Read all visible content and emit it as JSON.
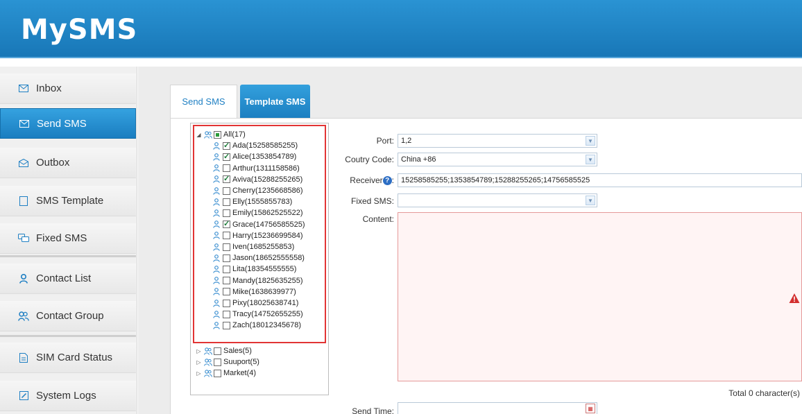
{
  "app": {
    "logo": "MySMS"
  },
  "sidebar": {
    "items": [
      {
        "label": "Inbox",
        "icon": "envelope-icon"
      },
      {
        "label": "Send SMS",
        "icon": "envelope-send-icon",
        "active": true
      },
      {
        "label": "Outbox",
        "icon": "envelope-open-icon"
      },
      {
        "label": "SMS Template",
        "icon": "template-icon"
      },
      {
        "label": "Fixed SMS",
        "icon": "chat-bubbles-icon"
      },
      {
        "label": "Contact List",
        "icon": "person-icon"
      },
      {
        "label": "Contact Group",
        "icon": "people-icon"
      },
      {
        "label": "SIM Card Status",
        "icon": "document-icon"
      },
      {
        "label": "System Logs",
        "icon": "edit-icon"
      }
    ]
  },
  "tabs": {
    "send": "Send SMS",
    "template": "Template SMS"
  },
  "tree": {
    "root": {
      "label": "All(17)",
      "state": "partial"
    },
    "contacts": [
      {
        "label": "Ada(15258585255)",
        "checked": true
      },
      {
        "label": "Alice(1353854789)",
        "checked": true
      },
      {
        "label": "Arthur(1311158586)",
        "checked": false
      },
      {
        "label": "Aviva(15288255265)",
        "checked": true
      },
      {
        "label": "Cherry(1235668586)",
        "checked": false
      },
      {
        "label": "Elly(1555855783)",
        "checked": false
      },
      {
        "label": "Emily(15862525522)",
        "checked": false
      },
      {
        "label": "Grace(14756585525)",
        "checked": true
      },
      {
        "label": "Harry(15236699584)",
        "checked": false
      },
      {
        "label": "Iven(1685255853)",
        "checked": false
      },
      {
        "label": "Jason(18652555558)",
        "checked": false
      },
      {
        "label": "Lita(18354555555)",
        "checked": false
      },
      {
        "label": "Mandy(1825635255)",
        "checked": false
      },
      {
        "label": "Mike(1638639977)",
        "checked": false
      },
      {
        "label": "Pixy(18025638741)",
        "checked": false
      },
      {
        "label": "Tracy(14752655255)",
        "checked": false
      },
      {
        "label": "Zach(18012345678)",
        "checked": false
      }
    ],
    "groups": [
      {
        "label": "Sales(5)"
      },
      {
        "label": "Suuport(5)"
      },
      {
        "label": "Market(4)"
      }
    ]
  },
  "form": {
    "port_label": "Port:",
    "port_value": "1,2",
    "country_label": "Coutry Code:",
    "country_value": "China  +86",
    "receiver_label": "Receiver",
    "receiver_help": "?",
    "receiver_colon": ":",
    "receiver_value": "15258585255;1353854789;15288255265;14756585525",
    "fixed_label": "Fixed SMS:",
    "fixed_value": "",
    "content_label": "Content:",
    "content_value": "",
    "counter": "Total 0 character(s)",
    "send_time_label": "Send Time:",
    "send_time_value": ""
  },
  "colors": {
    "brand": "#1e82c6",
    "warning": "#d32f2f",
    "highlight_border": "#e23434"
  }
}
